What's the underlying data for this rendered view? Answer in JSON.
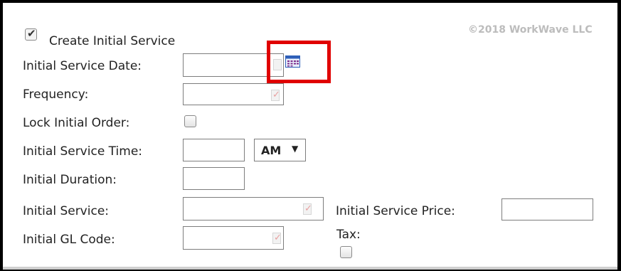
{
  "watermark": "©2018 WorkWave LLC",
  "create_initial_service": {
    "label": "Create Initial Service",
    "checked": true
  },
  "fields": {
    "initial_service_date": {
      "label": "Initial Service Date:",
      "value": ""
    },
    "frequency": {
      "label": "Frequency:",
      "value": ""
    },
    "lock_initial_order": {
      "label": "Lock Initial Order:",
      "checked": false
    },
    "initial_service_time": {
      "label": "Initial Service Time:",
      "value": "",
      "ampm": "AM",
      "ampm_arrow": "▼"
    },
    "initial_duration": {
      "label": "Initial Duration:",
      "value": ""
    },
    "initial_service": {
      "label": "Initial Service:",
      "value": ""
    },
    "initial_gl_code": {
      "label": "Initial GL Code:",
      "value": ""
    },
    "initial_service_price": {
      "label": "Initial Service Price:",
      "value": ""
    },
    "tax": {
      "label": "Tax:",
      "checked": false
    }
  },
  "icons": {
    "calendar": "calendar-icon",
    "lookup": "lookup-icon"
  },
  "colors": {
    "highlight": "#e00000",
    "watermark": "#bcbcbc",
    "calendar_blue": "#2e5fb8"
  }
}
